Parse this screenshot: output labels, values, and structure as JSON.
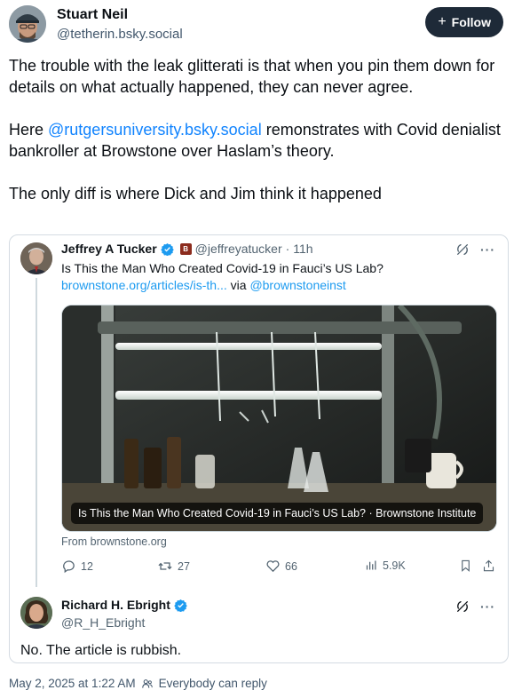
{
  "post": {
    "author_name": "Stuart Neil",
    "author_handle": "@tetherin.bsky.social",
    "follow_label": "Follow",
    "paragraph1": "The trouble with the leak glitterati is that when you pin them down for details on what actually happened, they can never agree.",
    "paragraph2_before": "Here ",
    "paragraph2_mention": "@rutgersuniversity.bsky.social",
    "paragraph2_after": " remonstrates with Covid denialist bankroller at Browstone over Haslam’s theory.",
    "paragraph3": "The only diff is where Dick and Jim think it happened",
    "timestamp": "May 2, 2025 at 1:22 AM",
    "reply_setting": "Everybody can reply"
  },
  "embed": {
    "tweet1": {
      "name": "Jeffrey A Tucker",
      "handle": "@jeffreyatucker",
      "time": "· 11h",
      "text": "Is This the Man Who Created Covid-19 in Fauci’s US Lab?",
      "link": "brownstone.org/articles/is-th...",
      "via_text": " via ",
      "via_handle": "@brownstoneinst",
      "media_caption": "Is This the Man Who Created Covid-19 in Fauci’s US Lab? · Brownstone Institute",
      "from_line": "From brownstone.org",
      "replies": "12",
      "reposts": "27",
      "likes": "66",
      "views": "5.9K"
    },
    "tweet2": {
      "name": "Richard H. Ebright",
      "handle": "@R_H_Ebright",
      "text": "No. The article is rubbish."
    }
  },
  "colors": {
    "follow_bg": "#1e2a38",
    "mention": "#1083fe",
    "link": "#1d9bf0",
    "verified": "#1d9bf0",
    "muted": "#536471"
  },
  "icons": [
    "plus-icon",
    "verified-icon",
    "org-badge-icon",
    "grok-icon",
    "more-icon",
    "reply-icon",
    "repost-icon",
    "like-icon",
    "views-icon",
    "bookmark-icon",
    "share-icon",
    "people-icon"
  ]
}
